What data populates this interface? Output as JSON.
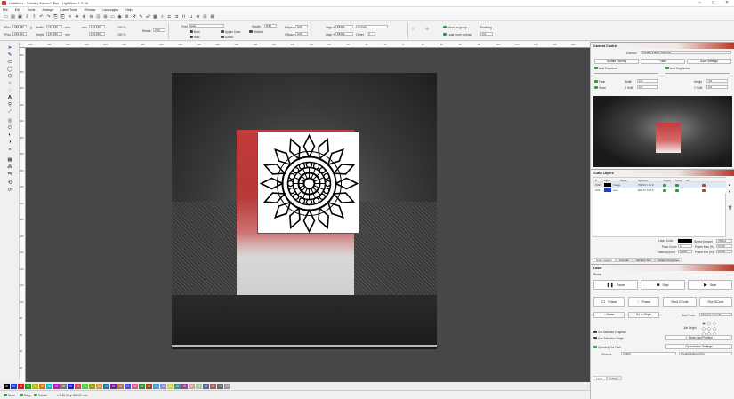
{
  "window": {
    "title": "Untitled * - Creality Falcon2 Pro - LightBurn 1.6.00"
  },
  "menu": [
    "File",
    "Edit",
    "Tools",
    "Arrange",
    "Laser Tools",
    "Window",
    "Languages",
    "Help"
  ],
  "props": {
    "xpos_label": "XPos",
    "xpos": "186.282",
    "ypos_label": "YPos",
    "ypos": "219.904",
    "width_label": "Width",
    "width": "145.160",
    "height_label": "Height",
    "height": "145.200",
    "unit": "mm",
    "rotate_label": "Rotate",
    "rotate": "0.00",
    "font_label": "Font",
    "font": "Arial",
    "height2_label": "Height",
    "height2": "8.00",
    "hspace_label": "HSpace",
    "hspace": "0.00",
    "vspace_label": "VSpace",
    "vspace": "0.00",
    "bold": "Bold",
    "italic": "Italic",
    "upper": "Upper Case",
    "distort": "Distort",
    "welded": "Welded",
    "alignx_label": "Align X",
    "alignx": "Middle",
    "aligny_label": "Align Y",
    "aligny": "Middle",
    "normal": "Normal",
    "offset_label": "Offset",
    "offset": "0",
    "move_groups": "Move as group",
    "load_unique": "Load more objects",
    "enabling": "Enabling",
    "enabling_val": "0.0"
  },
  "ruler_top": [
    "400",
    "380",
    "360",
    "340",
    "320",
    "300",
    "280",
    "260",
    "240",
    "220",
    "200",
    "180",
    "160",
    "140",
    "120",
    "100",
    "80",
    "60",
    "40",
    "20",
    "0",
    "20",
    "40",
    "60",
    "80",
    "100",
    "120",
    "140",
    "160",
    "180"
  ],
  "ruler_left": [
    "400",
    "380",
    "360",
    "340",
    "320",
    "300",
    "280",
    "260",
    "240",
    "220",
    "200",
    "180",
    "160",
    "140",
    "120",
    "100",
    "80",
    "60",
    "40",
    "20"
  ],
  "palette": [
    "00",
    "01",
    "02",
    "03",
    "04",
    "05",
    "06",
    "07",
    "08",
    "09",
    "10",
    "11",
    "12",
    "13",
    "14",
    "15",
    "16",
    "17",
    "18",
    "19",
    "20",
    "21",
    "22",
    "23",
    "24",
    "25",
    "26",
    "27",
    "28",
    "29",
    "T1",
    "T2"
  ],
  "palette_colors": [
    "#000000",
    "#1a3fd0",
    "#d01a1a",
    "#1a9a1a",
    "#b8b81a",
    "#d07a1a",
    "#1ab8b8",
    "#b81ab8",
    "#777777",
    "#1a1ad0",
    "#d04a4a",
    "#4ad04a",
    "#9a9a1a",
    "#d09a4a",
    "#1a7a9a",
    "#7a1a9a",
    "#aa7755",
    "#4a4ad0",
    "#e05a8a",
    "#3a8a3a",
    "#9a4a1a",
    "#4a9ad0",
    "#8a8ad0",
    "#d0d04a",
    "#4a8a8a",
    "#8a4a8a",
    "#d0a0a0",
    "#a0d0a0",
    "#6060a0",
    "#a06060",
    "#666666",
    "#999999"
  ],
  "status": {
    "move": "Move",
    "snap": "Snap",
    "hidden": "Hidden",
    "coords": "x: 138.00 y: 422.00 mm"
  },
  "camera": {
    "title": "Camera Control",
    "device_label": "Camera",
    "device": "Creality Falcon Camera",
    "update_overlay": "Update Overlay",
    "trace": "Trace",
    "save_settings": "Save Settings",
    "auto_exposure": "Auto Exposure",
    "auto_brightness": "Auto Brightness",
    "fade": "Fade",
    "show": "Show",
    "width_label": "Width",
    "width": "2.0",
    "height_label": "Height",
    "height": "4.0",
    "xshift_label": "X Shift",
    "xshift": "0.0",
    "yshift_label": "Y Shift",
    "yshift": "0.0"
  },
  "cuts": {
    "title": "Cuts / Layers",
    "headers": [
      "#",
      "Layer",
      "Mode",
      "Spd/Pwr",
      "Output",
      "Show",
      "Air"
    ],
    "rows": [
      {
        "num": "C00",
        "mode": "Image",
        "spd": "7000.0 / 10.0",
        "color": "#000000"
      },
      {
        "num": "C01",
        "mode": "Line",
        "spd": "600.0 / 100.0",
        "color": "#1a3fd0"
      }
    ],
    "layer_color": "Layer Color",
    "speed_label": "Speed (mm/m)",
    "speed": "7000.0",
    "pass_label": "Pass Count",
    "pass": "1",
    "power_max_label": "Power Max (%)",
    "power_max": "10.00",
    "interval_label": "Interval (mm)",
    "interval": "0.100",
    "power_min_label": "Power Min (%)",
    "power_min": "10.00",
    "tabs": [
      "Cuts / Layers",
      "Console",
      "Variable Text",
      "Shape Properties"
    ]
  },
  "laser": {
    "title": "Laser",
    "state": "Ready",
    "pause": "Pause",
    "stop": "Stop",
    "start": "Start",
    "frame1": "Frame",
    "frame2": "Frame",
    "send_gcode": "Send GCode",
    "run_gcode": "Run GCode",
    "home": "Home",
    "go_to_origin": "Go to Origin",
    "start_from_label": "Start From:",
    "start_from": "Absolute Coords",
    "job_origin": "Job Origin",
    "cut_selected": "Cut Selected Graphics",
    "use_selection": "Use Selection Origin",
    "optimize_cut": "Optimize Cut Path",
    "show_last": "Show Last Position",
    "optimize_settings": "Optimization Settings",
    "devices_label": "Devices",
    "port": "COM4",
    "profile": "Creality Falcon2 Pro",
    "tabs": [
      "Laser",
      "Library"
    ]
  }
}
